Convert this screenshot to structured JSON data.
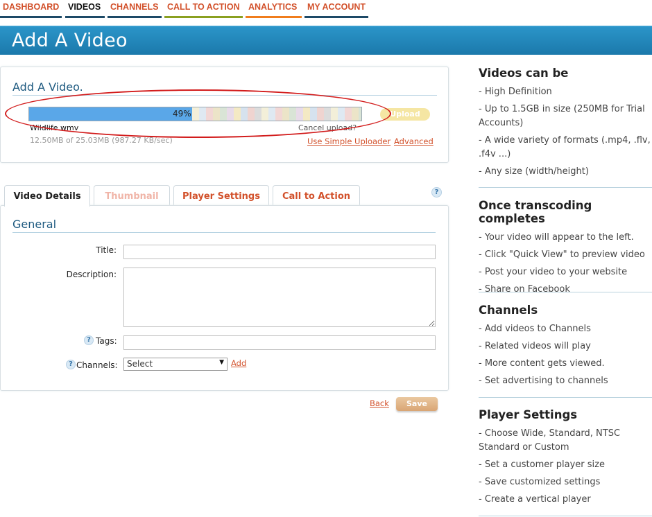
{
  "nav": [
    {
      "label": "DASHBOARD",
      "color": "#d2512b",
      "underline": "#1d4a67"
    },
    {
      "label": "VIDEOS",
      "color": "#111111",
      "underline": "#1d4a67"
    },
    {
      "label": "CHANNELS",
      "color": "#d2512b",
      "underline": "#1d4a67"
    },
    {
      "label": "CALL TO ACTION",
      "color": "#d2512b",
      "underline": "#8aa020"
    },
    {
      "label": "ANALYTICS",
      "color": "#d2512b",
      "underline": "#f07d1c"
    },
    {
      "label": "MY ACCOUNT",
      "color": "#d2512b",
      "underline": "#1d4a67"
    }
  ],
  "header": {
    "title": "Add A Video"
  },
  "upload": {
    "title": "Add A Video.",
    "progress_percent": 49,
    "progress_label": "49%",
    "upload_button": "Upload",
    "filename": "Wildlife.wmv",
    "filesize": "12.50MB of 25.03MB (987.27 KB/sec)",
    "cancel_label": "Cancel upload?",
    "simple_uploader_link": "Use Simple Uploader",
    "advanced_link": "Advanced"
  },
  "tabs": [
    {
      "label": "Video Details",
      "state": "active"
    },
    {
      "label": "Thumbnail",
      "state": "disabled"
    },
    {
      "label": "Player Settings",
      "state": "normal"
    },
    {
      "label": "Call to Action",
      "state": "normal"
    }
  ],
  "help_icon_label": "?",
  "form": {
    "section_title": "General",
    "title_label": "Title:",
    "title_value": "",
    "description_label": "Description:",
    "description_value": "",
    "tags_label": "Tags:",
    "tags_value": "",
    "channels_label": "Channels:",
    "channels_selected": "Select",
    "channels_dropdown_arrow": "▼",
    "add_link": "Add",
    "back_link": "Back",
    "save_button": "Save"
  },
  "sidebar": [
    {
      "title": "Videos can be",
      "items": [
        "- High Definition",
        "- Up to 1.5GB in size (250MB for Trial Accounts)",
        "- A wide variety of formats (.mp4, .flv, .f4v ...)",
        "- Any size (width/height)"
      ]
    },
    {
      "title": "Once transcoding completes",
      "items": [
        "- Your video will appear to the left.",
        "- Click \"Quick View\" to preview video",
        "- Post your video to your website",
        "- Share on Facebook"
      ]
    },
    {
      "title": "Channels",
      "items": [
        "- Add videos to Channels",
        "- Related videos will play",
        "- More content gets viewed.",
        "- Set advertising to channels"
      ]
    },
    {
      "title": "Player Settings",
      "items": [
        "- Choose Wide, Standard, NTSC Standard or Custom",
        "- Set a customer player size",
        "- Save customized settings",
        "- Create a vertical player"
      ]
    }
  ],
  "colors": {
    "accent": "#d2512b",
    "header_blue": "#1b79ab",
    "annotation_red": "#d21c1c"
  }
}
